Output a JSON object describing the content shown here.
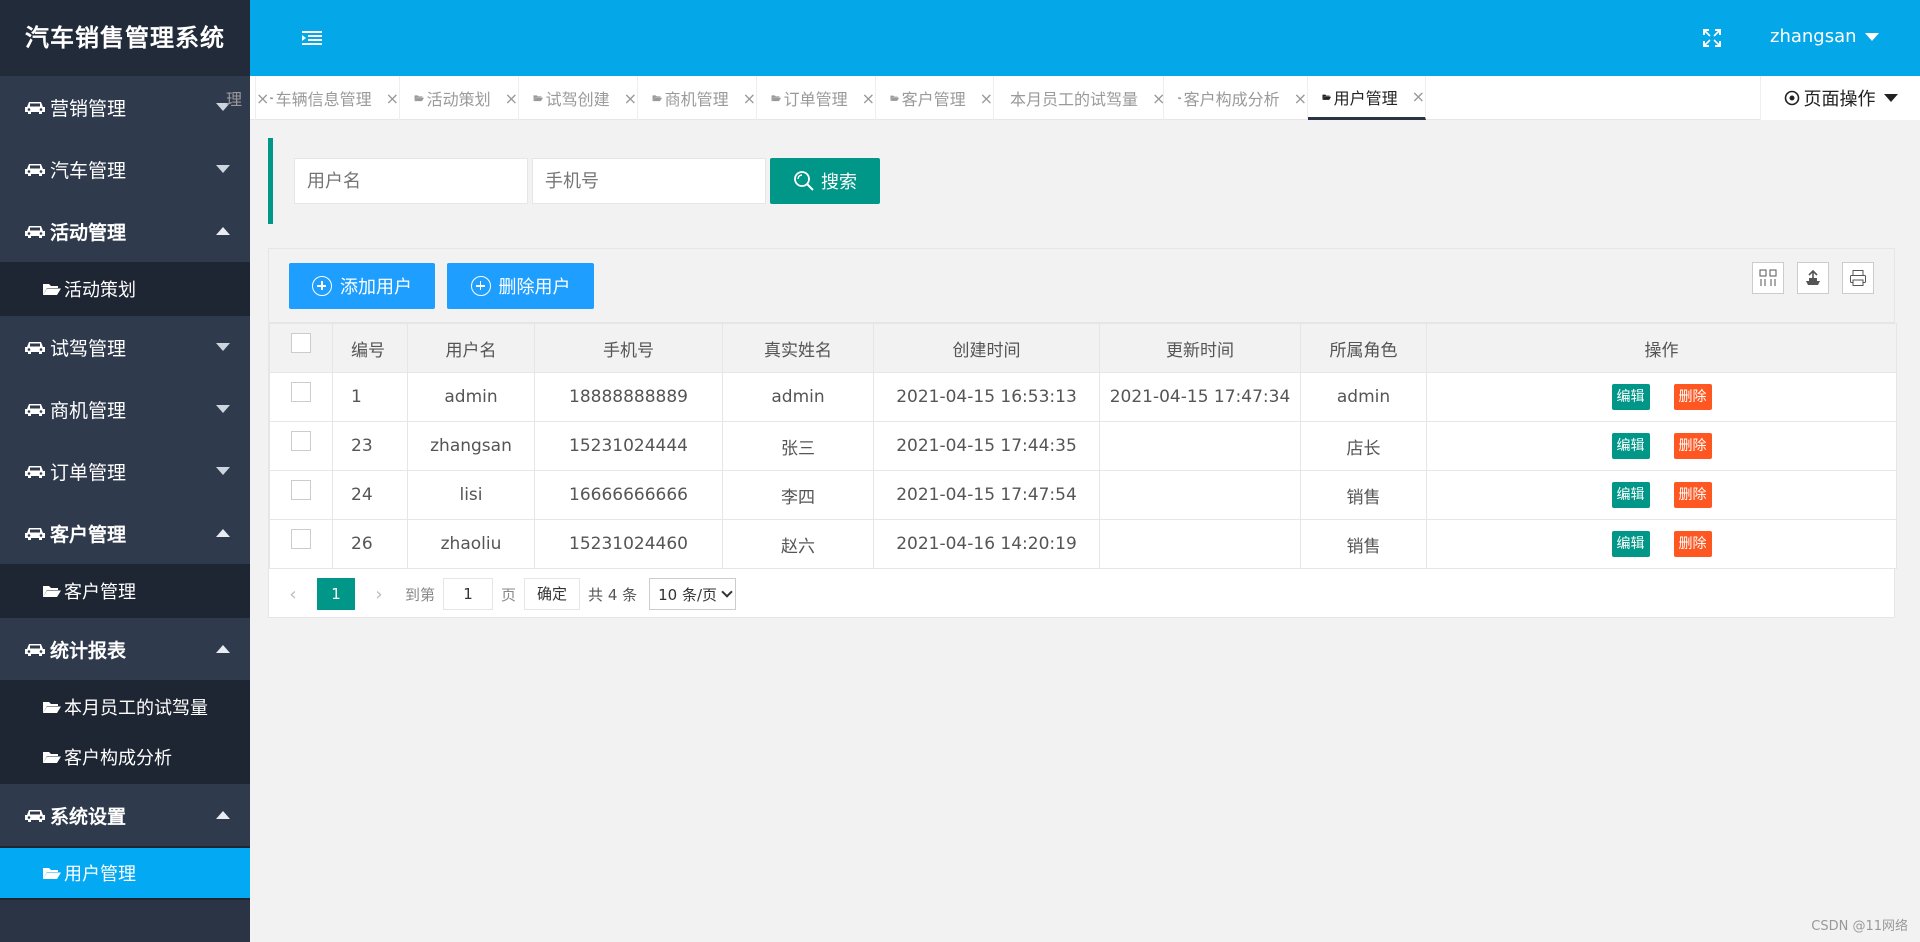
{
  "app": {
    "title": "汽车销售管理系统"
  },
  "sidebar": {
    "groups": [
      {
        "label": "营销管理",
        "expanded": false,
        "items": []
      },
      {
        "label": "汽车管理",
        "expanded": false,
        "items": []
      },
      {
        "label": "活动管理",
        "expanded": true,
        "items": [
          {
            "label": "活动策划"
          }
        ]
      },
      {
        "label": "试驾管理",
        "expanded": false,
        "items": []
      },
      {
        "label": "商机管理",
        "expanded": false,
        "items": []
      },
      {
        "label": "订单管理",
        "expanded": false,
        "items": []
      },
      {
        "label": "客户管理",
        "expanded": true,
        "items": [
          {
            "label": "客户管理"
          }
        ]
      },
      {
        "label": "统计报表",
        "expanded": true,
        "items": [
          {
            "label": "本月员工的试驾量"
          },
          {
            "label": "客户构成分析"
          }
        ]
      },
      {
        "label": "系统设置",
        "expanded": true,
        "items": [
          {
            "label": "用户管理",
            "active": true
          }
        ]
      }
    ]
  },
  "header": {
    "username": "zhangsan"
  },
  "tabs": [
    {
      "label": "理",
      "icon": false
    },
    {
      "label": "车辆信息管理",
      "icon": true
    },
    {
      "label": "活动策划",
      "icon": true
    },
    {
      "label": "试驾创建",
      "icon": true
    },
    {
      "label": "商机管理",
      "icon": true
    },
    {
      "label": "订单管理",
      "icon": true
    },
    {
      "label": "客户管理",
      "icon": true
    },
    {
      "label": "本月员工的试驾量",
      "icon": true
    },
    {
      "label": "客户构成分析",
      "icon": true
    },
    {
      "label": "用户管理",
      "icon": true,
      "active": true
    }
  ],
  "page_ops": {
    "label": "页面操作"
  },
  "search": {
    "username_placeholder": "用户名",
    "phone_placeholder": "手机号",
    "button": "搜索"
  },
  "toolbar": {
    "add": "添加用户",
    "delete": "删除用户"
  },
  "table": {
    "headers": [
      "编号",
      "用户名",
      "手机号",
      "真实姓名",
      "创建时间",
      "更新时间",
      "所属角色",
      "操作"
    ],
    "rows": [
      {
        "id": "1",
        "username": "admin",
        "phone": "18888888889",
        "realname": "admin",
        "created": "2021-04-15 16:53:13",
        "updated": "2021-04-15 17:47:34",
        "role": "admin"
      },
      {
        "id": "23",
        "username": "zhangsan",
        "phone": "15231024444",
        "realname": "张三",
        "created": "2021-04-15 17:44:35",
        "updated": "",
        "role": "店长"
      },
      {
        "id": "24",
        "username": "lisi",
        "phone": "16666666666",
        "realname": "李四",
        "created": "2021-04-15 17:47:54",
        "updated": "",
        "role": "销售"
      },
      {
        "id": "26",
        "username": "zhaoliu",
        "phone": "15231024460",
        "realname": "赵六",
        "created": "2021-04-16 14:20:19",
        "updated": "",
        "role": "销售"
      }
    ],
    "edit_label": "编辑",
    "delete_label": "删除"
  },
  "pager": {
    "current": "1",
    "goto_label": "到第",
    "goto_value": "1",
    "page_label": "页",
    "confirm": "确定",
    "total": "共 4 条",
    "page_size": "10 条/页"
  },
  "watermark": "CSDN @11网络"
}
